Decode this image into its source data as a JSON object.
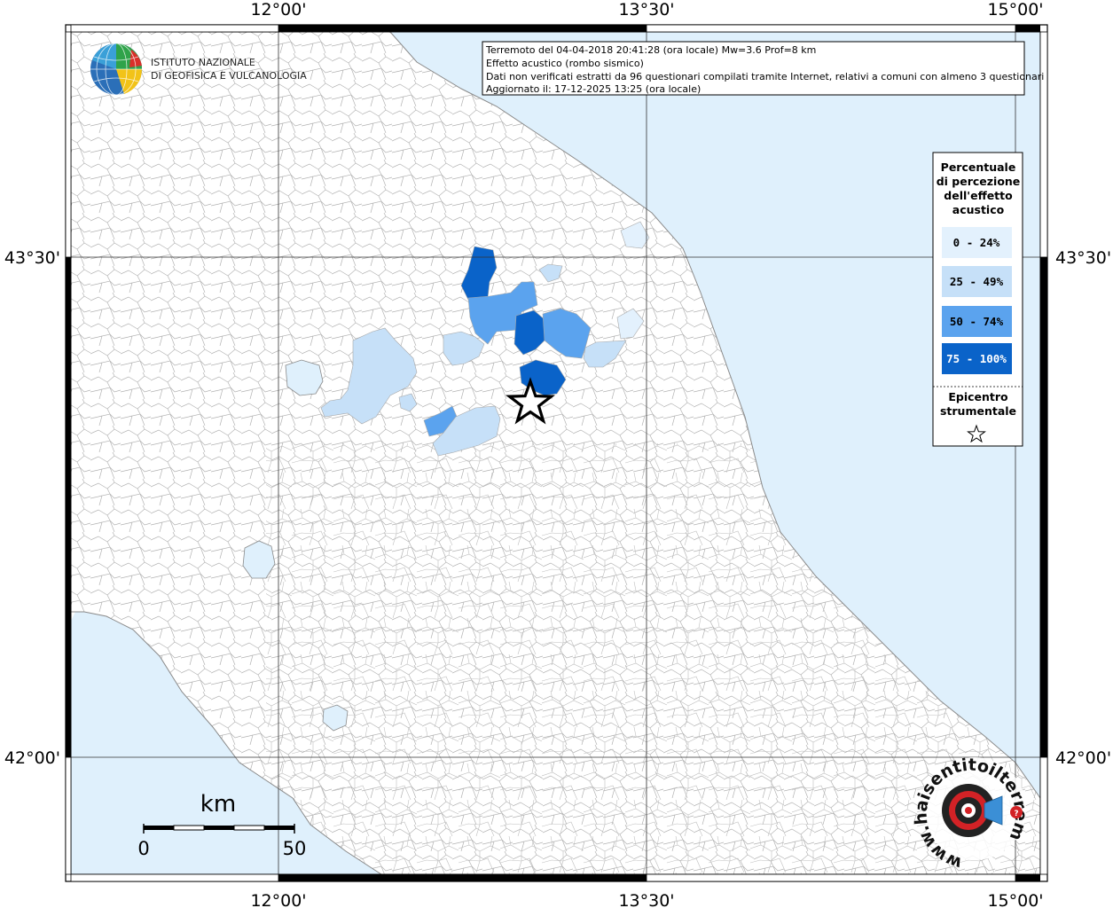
{
  "info": {
    "line1": "Terremoto del 04-04-2018 20:41:28 (ora locale) Mw=3.6 Prof=8 km",
    "line2": "Effetto acustico (rombo sismico)",
    "line3": "Dati non verificati estratti da 96 questionari compilati tramite Internet, relativi a comuni con almeno 3 questionari",
    "line4": "Aggiornato il: 17-12-2025 13:25 (ora locale)"
  },
  "ticks": {
    "lon": [
      "12°00'",
      "13°30'",
      "15°00'"
    ],
    "lat": [
      "43°30'",
      "42°00'"
    ]
  },
  "legend": {
    "title": [
      "Percentuale",
      "di percezione",
      "dell'effetto",
      "acustico"
    ],
    "classes": [
      {
        "label": "0 - 24%",
        "color": "#e3f1fd"
      },
      {
        "label": "25 - 49%",
        "color": "#c6e0f8"
      },
      {
        "label": "50 - 74%",
        "color": "#5ba3ee"
      },
      {
        "label": "75 - 100%",
        "color": "#0a63c9"
      }
    ],
    "epicenter_title": [
      "Epicentro",
      "strumentale"
    ]
  },
  "scalebar": {
    "unit": "km",
    "min": "0",
    "max": "50"
  },
  "logo": {
    "line1": "ISTITUTO NAZIONALE",
    "line2": "DI GEOFISICA E VULCANOLOGIA"
  },
  "badge": {
    "text": "www.haisentitoilterremoto.it"
  },
  "colors": {
    "sea": "#dff0fc",
    "land": "#ffffff",
    "border": "#a8a8a8",
    "grid": "#333333"
  }
}
